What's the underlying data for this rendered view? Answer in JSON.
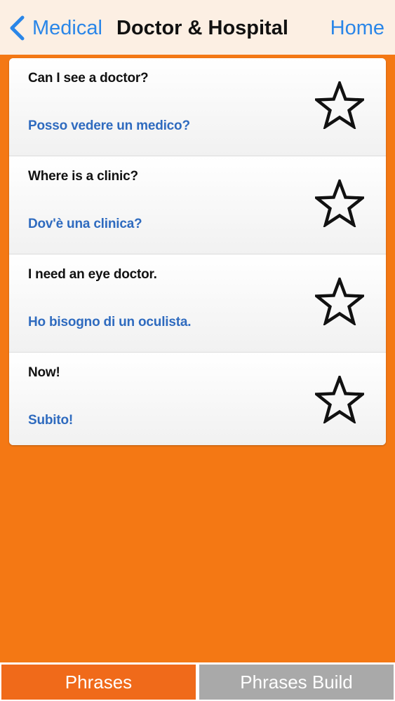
{
  "navbar": {
    "back_label": "Medical",
    "title": "Doctor & Hospital",
    "home_label": "Home"
  },
  "phrases": [
    {
      "english": "Can I see a doctor?",
      "italian": "Posso vedere un medico?",
      "favorite": false
    },
    {
      "english": "Where is a clinic?",
      "italian": "Dov'è una clinica?",
      "favorite": false
    },
    {
      "english": "I need an eye doctor.",
      "italian": "Ho bisogno di un oculista.",
      "favorite": false
    },
    {
      "english": "Now!",
      "italian": "Subito!",
      "favorite": false
    }
  ],
  "tabs": {
    "phrases": "Phrases",
    "phrases_build": "Phrases Build"
  },
  "colors": {
    "background": "#f47814",
    "accent_blue": "#2a86e8",
    "italian_text": "#2f6bbf",
    "active_tab": "#f06a1a",
    "inactive_tab": "#a9a9a9"
  },
  "icons": {
    "back": "chevron-left-icon",
    "favorite": "star-outline-icon"
  }
}
